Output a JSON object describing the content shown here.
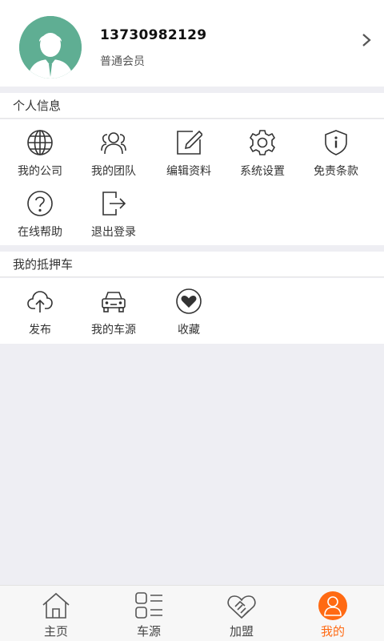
{
  "profile": {
    "phone": "13730982129",
    "level": "普通会员"
  },
  "sections": {
    "personal": "个人信息",
    "mortgage": "我的抵押车"
  },
  "personal_items": [
    {
      "label": "我的公司",
      "icon": "globe-icon"
    },
    {
      "label": "我的团队",
      "icon": "team-icon"
    },
    {
      "label": "编辑资料",
      "icon": "edit-icon"
    },
    {
      "label": "系统设置",
      "icon": "gear-icon"
    },
    {
      "label": "免责条款",
      "icon": "shield-icon"
    },
    {
      "label": "在线帮助",
      "icon": "help-icon"
    },
    {
      "label": "退出登录",
      "icon": "logout-icon"
    }
  ],
  "mortgage_items": [
    {
      "label": "发布",
      "icon": "cloud-upload-icon"
    },
    {
      "label": "我的车源",
      "icon": "car-icon"
    },
    {
      "label": "收藏",
      "icon": "heart-icon"
    }
  ],
  "tabs": [
    {
      "label": "主页",
      "icon": "home-icon"
    },
    {
      "label": "车源",
      "icon": "list-icon"
    },
    {
      "label": "加盟",
      "icon": "handshake-icon"
    },
    {
      "label": "我的",
      "icon": "user-icon",
      "active": true
    }
  ],
  "colors": {
    "accent": "#ff6a13",
    "avatar": "#5fae93",
    "background": "#eeeef3"
  }
}
